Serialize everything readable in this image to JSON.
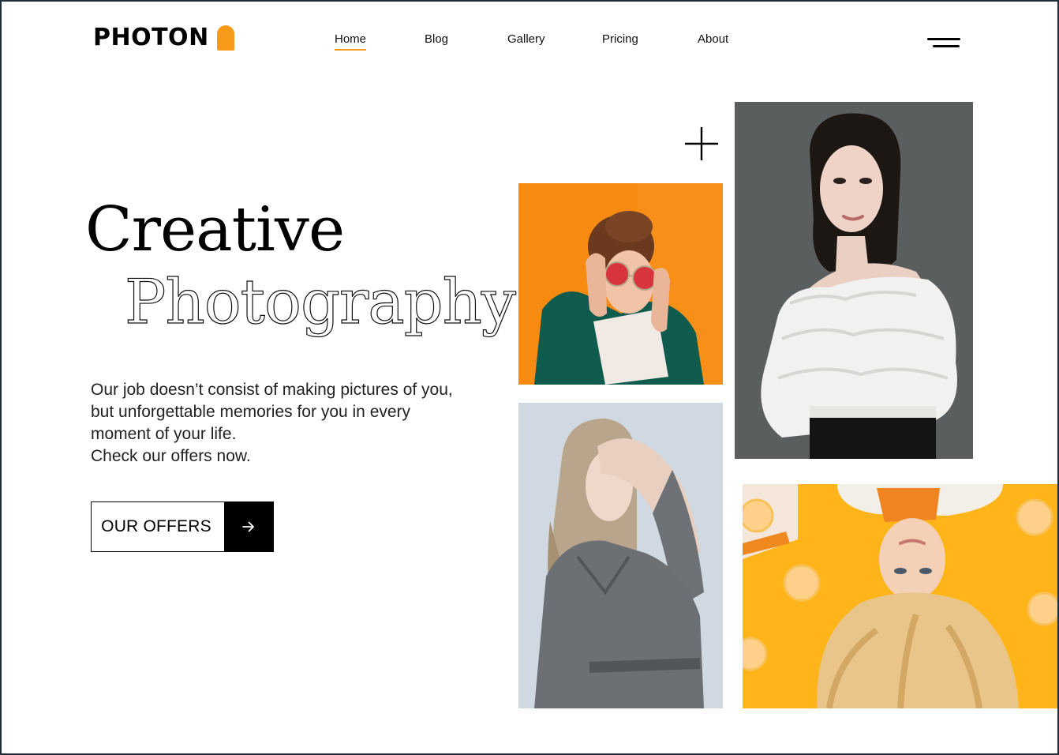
{
  "brand": {
    "name": "PHOTON",
    "accent_color": "#f79a1a"
  },
  "nav": {
    "items": [
      {
        "label": "Home",
        "active": true
      },
      {
        "label": "Blog",
        "active": false
      },
      {
        "label": "Gallery",
        "active": false
      },
      {
        "label": "Pricing",
        "active": false
      },
      {
        "label": "About",
        "active": false
      }
    ],
    "menu_icon": "hamburger-icon"
  },
  "hero": {
    "title_line_1": "Creative",
    "title_line_2": "Photography",
    "description_lines": [
      "Our job doesn’t consist of making pictures of you,",
      "but unforgettable memories for you in every",
      "moment of your life.",
      "Check our offers now."
    ],
    "cta_label": "OUR OFFERS",
    "cta_icon": "arrow-right-icon"
  },
  "decor": {
    "plus_icon": "plus-icon"
  },
  "gallery": {
    "photos": [
      {
        "subject": "woman in red heart sunglasses on orange background",
        "bg": "#f78b12"
      },
      {
        "subject": "woman in white off-shoulder ruffled blouse on grey background",
        "bg": "#545658"
      },
      {
        "subject": "blonde woman in grey shirt covering face",
        "bg": "#c8d1db"
      },
      {
        "subject": "upside-down blonde woman with orange slices on yellow background",
        "bg": "#ffb41a"
      }
    ]
  }
}
